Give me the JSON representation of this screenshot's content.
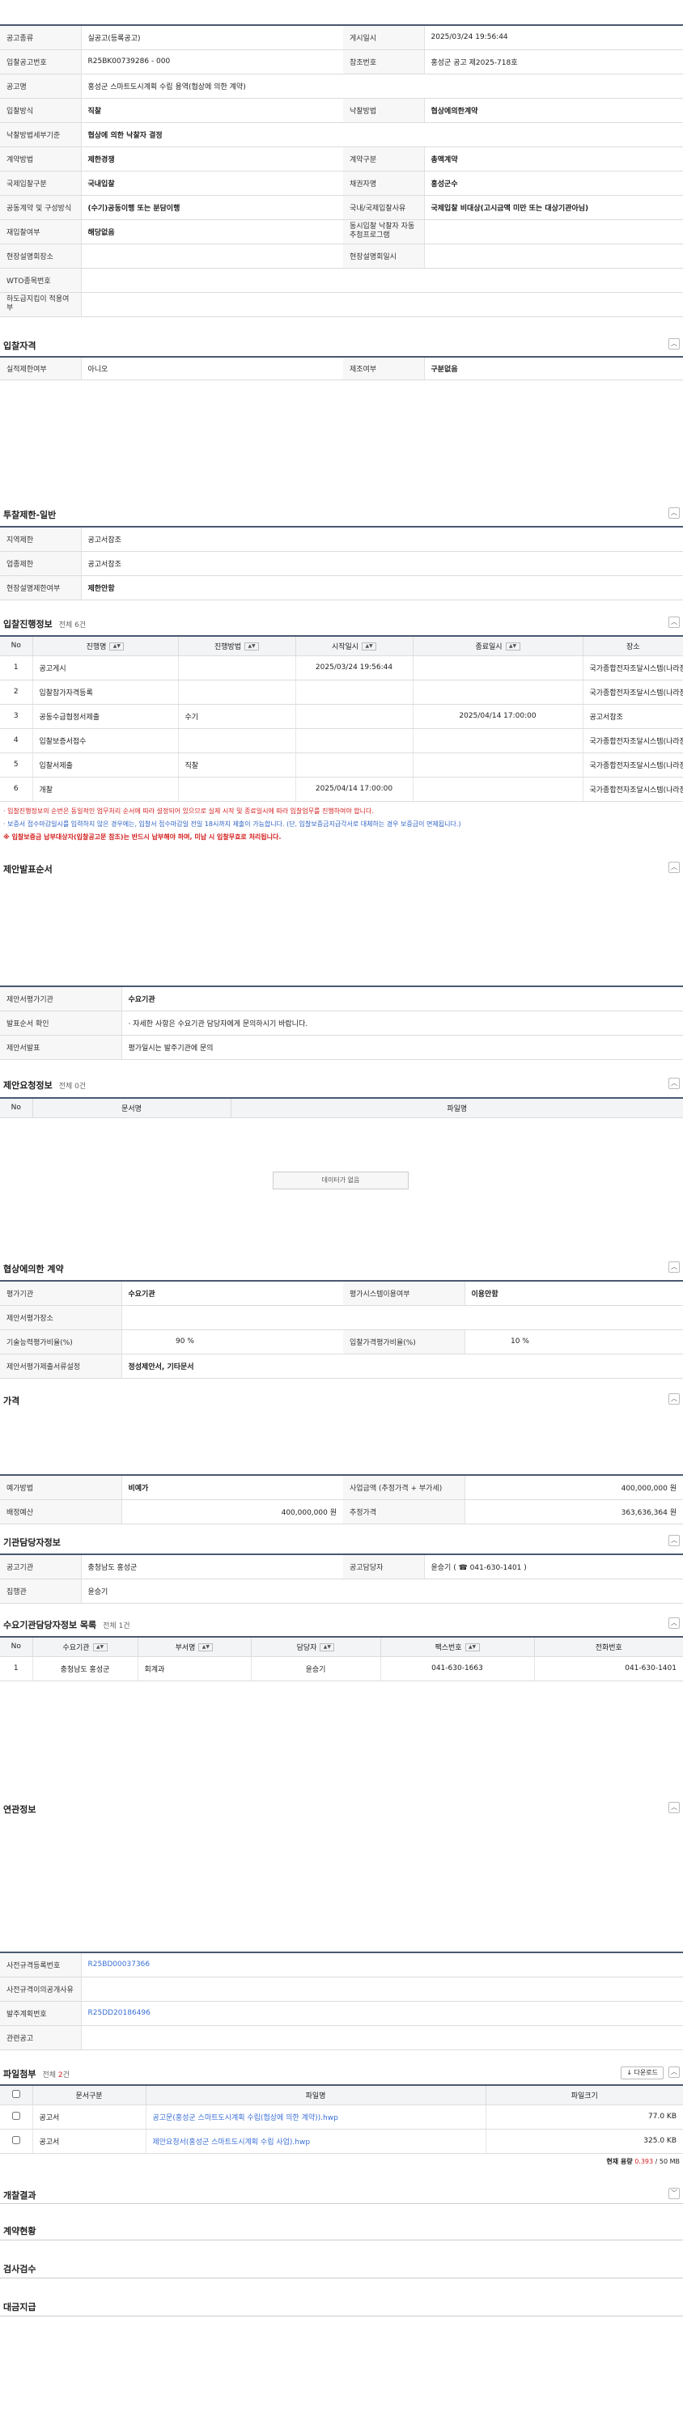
{
  "general": {
    "r1": {
      "k1": "공고종류",
      "v1": "실공고(등록공고)",
      "k2": "게시일시",
      "v2": "2025/03/24 19:56:44"
    },
    "r2": {
      "k1": "입찰공고번호",
      "v1": "R25BK00739286 - 000",
      "k2": "참조번호",
      "v2": "홍성군 공고 제2025-718호"
    },
    "r3": {
      "k1": "공고명",
      "v1": "홍성군 스마트도시계획 수립 용역(협상에 의한 계약)"
    },
    "r4": {
      "k1": "입찰방식",
      "v1": "직찰",
      "k2": "낙찰방법",
      "v2": "협상에의한계약"
    },
    "r5": {
      "k1": "낙찰방법세부기준",
      "v1": "협상에 의한 낙찰자 결정"
    },
    "r6": {
      "k1": "계약방법",
      "v1": "제한경쟁",
      "k2": "계약구분",
      "v2": "총액계약"
    },
    "r7": {
      "k1": "국제입찰구분",
      "v1": "국내입찰",
      "k2": "채권자명",
      "v2": "홍성군수"
    },
    "r8": {
      "k1": "공동계약 및 구성방식",
      "v1": "(수기)공동이행 또는 분담이행",
      "k2": "국내/국제입찰사유",
      "v2": "국제입찰 비대상(고시금액 미만 또는 대상기관아님)"
    },
    "r9": {
      "k1": "재입찰여부",
      "v1": "해당없음",
      "k2": "동시입찰 낙찰자 자동추첨프로그램",
      "v2": ""
    },
    "r10": {
      "k1": "현장설명회장소",
      "v1": "",
      "k2": "현장설명회일시",
      "v2": ""
    },
    "r11": {
      "k1": "WTO종목번호",
      "v1": ""
    },
    "r12": {
      "k1": "하도급지킴이 적용여부",
      "v1": ""
    }
  },
  "qual": {
    "title": "입찰자격",
    "k1": "실적제한여부",
    "v1": "아니오",
    "k2": "제조여부",
    "v2": "구분없음"
  },
  "limit": {
    "title": "투찰제한-일반",
    "rows": [
      {
        "k": "지역제한",
        "v": "공고서참조"
      },
      {
        "k": "업종제한",
        "v": "공고서참조"
      },
      {
        "k": "현장설명제한여부",
        "v": "제한안함"
      }
    ]
  },
  "progress": {
    "title": "입찰진행정보",
    "count": "전체 6건",
    "headers": [
      "No",
      "진행명",
      "진행방법",
      "시작일시",
      "종료일시",
      "장소"
    ],
    "rows": [
      [
        "1",
        "공고게시",
        "",
        "2025/03/24 19:56:44",
        "",
        "국가종합전자조달시스템(나라장터)"
      ],
      [
        "2",
        "입찰참가자격등록",
        "",
        "",
        "",
        "국가종합전자조달시스템(나라장터)"
      ],
      [
        "3",
        "공동수급협정서제출",
        "수기",
        "",
        "2025/04/14 17:00:00",
        "공고서참조"
      ],
      [
        "4",
        "입찰보증서접수",
        "",
        "",
        "",
        "국가종합전자조달시스템(나라장터)"
      ],
      [
        "5",
        "입찰서제출",
        "직찰",
        "",
        "",
        "국가종합전자조달시스템(나라장터)"
      ],
      [
        "6",
        "개찰",
        "",
        "2025/04/14 17:00:00",
        "",
        "국가종합전자조달시스템(나라장터)"
      ]
    ],
    "notes": [
      "· 입찰진행정보의 순번은 동일적인 업무처리 순서에 따라 설정되어 있으므로 실제 시작 및 종료일시에 따라 입찰업무를 진행하여야 합니다.",
      "· 보증서 접수마감일시를 입력하지 않은 경우에는, 입찰서 접수마감일 전일 18시까지 제출이 가능합니다. (단, 입찰보증금지급각서로 대체하는 경우 보증금이 면제됩니다.)",
      "※ 입찰보증금 납부대상자(입찰공고문 참조)는 반드시 납부해야 하며, 미납 시 입찰무효로 처리됩니다."
    ]
  },
  "proposal": {
    "title": "제안발표순서",
    "rows": [
      {
        "k": "제안서평가기관",
        "v": "수요기관"
      },
      {
        "k": "발표순서 확인",
        "v": "· 자세한 사항은 수요기관 담당자에게 문의하시기 바랍니다."
      },
      {
        "k": "제안서발표",
        "v": "평가일시는 발주기관에 문의"
      }
    ]
  },
  "request": {
    "title": "제안요청정보",
    "count": "전체 0건",
    "headers": [
      "No",
      "문서명",
      "파일명"
    ],
    "empty": "데이터가 없음"
  },
  "nego": {
    "title": "협상에의한 계약",
    "k1": "평가기관",
    "v1": "수요기관",
    "k2": "평가시스템이용여부",
    "v2": "이용안함",
    "k3": "제안서평가장소",
    "k4": "기술능력평가비율(%)",
    "v4": "90",
    "unit": "%",
    "k5": "입찰가격평가비율(%)",
    "v5": "10",
    "k6": "제안서평가제출서류설정",
    "v6": "정성제안서, 기타문서"
  },
  "price": {
    "title": "가격",
    "k1": "예가방법",
    "v1": "비예가",
    "k2": "사업금액 (추정가격 + 부가세)",
    "v2": "400,000,000 원",
    "k3": "배정예산",
    "v3": "400,000,000 원",
    "k4": "추정가격",
    "v4": "363,636,364 원"
  },
  "agency": {
    "title": "기관담당자정보",
    "k1": "공고기관",
    "v1": "충청남도 홍성군",
    "k2": "공고담당자",
    "v2": "윤승기 ( ☎ 041-630-1401 )",
    "k3": "집행관",
    "v3": "윤승기"
  },
  "demand": {
    "title": "수요기관담당자정보 목록",
    "count": "전체 1건",
    "headers": [
      "No",
      "수요기관",
      "부서명",
      "담당자",
      "팩스번호",
      "전화번호"
    ],
    "rows": [
      [
        "1",
        "충청남도 홍성군",
        "회계과",
        "윤승기",
        "041-630-1663",
        "041-630-1401"
      ]
    ]
  },
  "related": {
    "title": "연관정보",
    "rows": [
      {
        "k": "사전규격등록번호",
        "v": "R25BD00037366"
      },
      {
        "k": "사전규격이의공개사유",
        "v": ""
      },
      {
        "k": "발주계획번호",
        "v": "R25DD20186496"
      },
      {
        "k": "관련공고",
        "v": ""
      }
    ]
  },
  "files": {
    "title": "파일첨부",
    "count_prefix": "전체 ",
    "count_num": "2",
    "count_suffix": "건",
    "download": "↓ 다운로드",
    "headers": [
      "",
      "문서구분",
      "파일명",
      "파일크기"
    ],
    "rows": [
      [
        "공고서",
        "공고문(홍성군 스마트도시계획 수립(협상에 의한 계약)).hwp",
        "77.0 KB"
      ],
      [
        "공고서",
        "제안요청서(홍성군 스마트도시계획 수립 사업).hwp",
        "325.0 KB"
      ]
    ],
    "usage_label": "현재 용량",
    "usage_val": "0.393",
    "usage_total": " / 50 MB"
  },
  "bottom": {
    "s1": "개찰결과",
    "s2": "계약현황",
    "s3": "검사검수",
    "s4": "대금지급"
  }
}
